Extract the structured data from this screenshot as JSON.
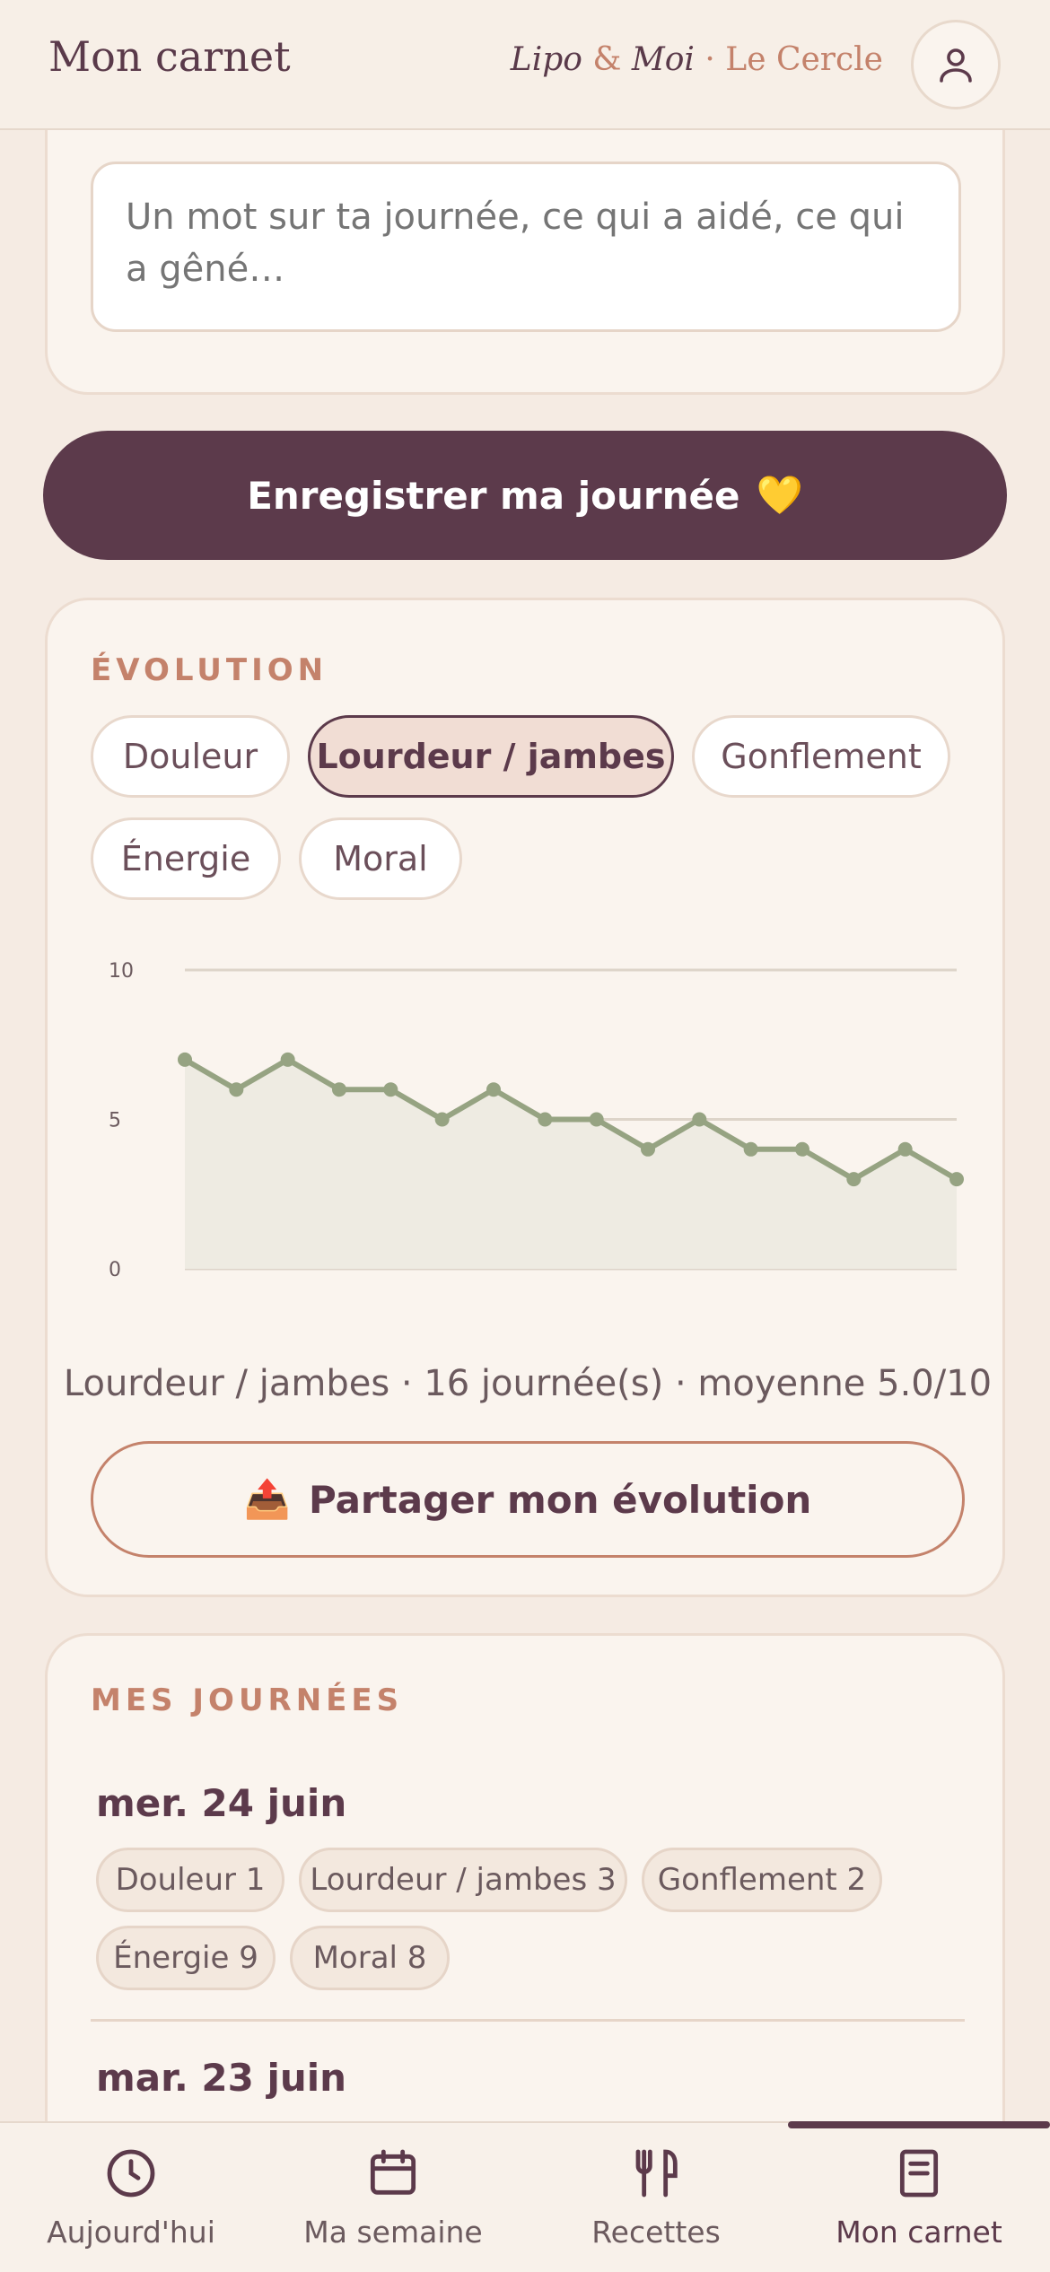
{
  "header": {
    "title": "Mon carnet",
    "brand_part1": "Lipo",
    "brand_amp": "&",
    "brand_part2": "Moi",
    "brand_dot": "·",
    "brand_circle": "Le Cercle",
    "profile_icon": "user-icon"
  },
  "note": {
    "placeholder": "Un mot sur ta journée, ce qui a aidé, ce qui a gêné…"
  },
  "save_button": {
    "label": "Enregistrer ma journée",
    "emoji": "💛"
  },
  "evolution": {
    "section_label": "ÉVOLUTION",
    "chips": [
      {
        "label": "Douleur",
        "active": false
      },
      {
        "label": "Lourdeur / jambes",
        "active": true
      },
      {
        "label": "Gonflement",
        "active": false
      },
      {
        "label": "Énergie",
        "active": false
      },
      {
        "label": "Moral",
        "active": false
      }
    ],
    "summary": "Lourdeur / jambes · 16 journée(s) · moyenne 5.0/10",
    "share_label": "Partager mon évolution",
    "share_icon": "📤"
  },
  "chart_data": {
    "type": "area",
    "title": "",
    "xlabel": "",
    "ylabel": "",
    "ylim": [
      0,
      10
    ],
    "yticks": [
      "0",
      "5",
      "10"
    ],
    "grid": true,
    "series": [
      {
        "values": [
          7,
          6,
          7,
          6,
          6,
          5,
          6,
          5,
          5,
          4,
          5,
          4,
          4,
          3,
          4,
          3
        ]
      }
    ],
    "colors": {
      "line": "#96a382",
      "fill": "#eeebe2"
    }
  },
  "journal": {
    "section_label": "MES JOURNÉES",
    "days": [
      {
        "date": "mer. 24 juin",
        "tags": [
          "Douleur 1",
          "Lourdeur / jambes 3",
          "Gonflement 2",
          "Énergie 9",
          "Moral 8"
        ]
      },
      {
        "date": "mar. 23 juin",
        "tags": []
      }
    ]
  },
  "nav": {
    "items": [
      {
        "label": "Aujourd'hui",
        "icon": "clock-icon"
      },
      {
        "label": "Ma semaine",
        "icon": "calendar-icon"
      },
      {
        "label": "Recettes",
        "icon": "utensils-icon"
      },
      {
        "label": "Mon carnet",
        "icon": "notebook-icon"
      }
    ],
    "active_index": 3
  },
  "colors": {
    "accent": "#5c3a4b",
    "secondary": "#c4826b",
    "background": "#f5ebe3",
    "card": "#faf4ee"
  }
}
